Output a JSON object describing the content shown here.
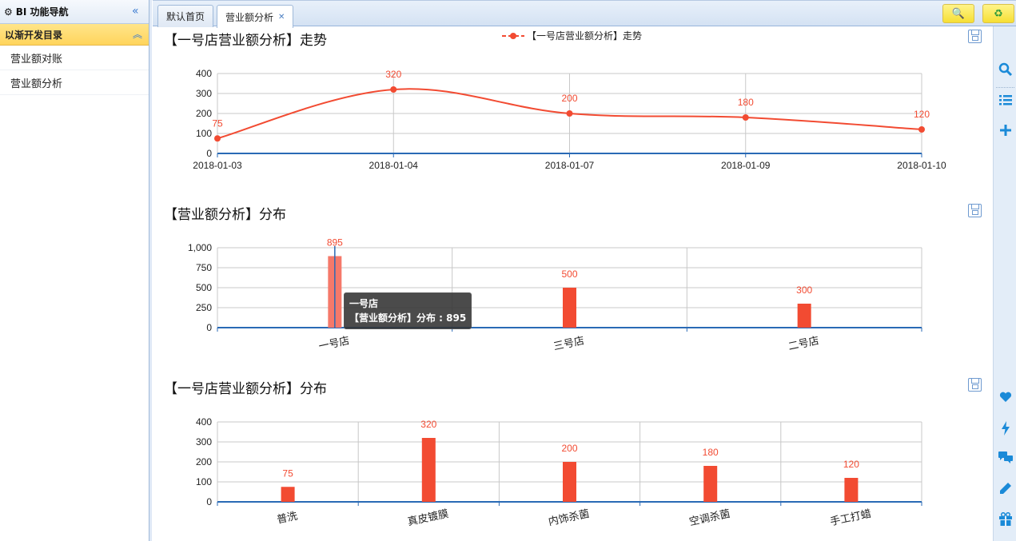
{
  "sidebar": {
    "title": "BI 功能导航",
    "group": "以渐开发目录",
    "items": [
      {
        "label": "营业额对账"
      },
      {
        "label": "营业额分析"
      }
    ]
  },
  "tabs": [
    {
      "label": "默认首页",
      "active": false
    },
    {
      "label": "营业额分析",
      "active": true,
      "closable": true
    }
  ],
  "toolbar": {
    "search_icon": "magnifier-icon",
    "refresh_icon": "recycle-icon"
  },
  "right_toolbar": [
    "search-icon",
    "list-icon",
    "plus-icon",
    "heart-icon",
    "lightning-icon",
    "chat-icon",
    "pencil-icon",
    "gift-icon"
  ],
  "colors": {
    "series": "#f24b32",
    "bar": "#f24b32",
    "bar_highlight": "#f5796a",
    "axis": "#2a6ab5"
  },
  "charts": {
    "trend": {
      "title": "【一号店营业额分析】走势",
      "legend": "【一号店营业额分析】走势"
    },
    "dist_store": {
      "title": "【营业额分析】分布",
      "tooltip_title": "一号店",
      "tooltip_value": "【营业额分析】分布 : 895"
    },
    "dist_service": {
      "title": "【一号店营业额分析】分布"
    }
  },
  "chart_data": [
    {
      "type": "line",
      "title": "【一号店营业额分析】走势",
      "x": [
        "2018-01-03",
        "2018-01-04",
        "2018-01-07",
        "2018-01-09",
        "2018-01-10"
      ],
      "series": [
        {
          "name": "【一号店营业额分析】走势",
          "values": [
            75,
            320,
            200,
            180,
            120
          ]
        }
      ],
      "yticks": [
        "0",
        "100",
        "200",
        "300",
        "400"
      ],
      "ylim": [
        0,
        400
      ],
      "grid": true,
      "legend": "top-center"
    },
    {
      "type": "bar",
      "title": "【营业额分析】分布",
      "categories": [
        "一号店",
        "三号店",
        "二号店"
      ],
      "values": [
        895,
        500,
        300
      ],
      "yticks": [
        "0",
        "250",
        "500",
        "750",
        "1,000"
      ],
      "ylim": [
        0,
        1000
      ],
      "grid": true
    },
    {
      "type": "bar",
      "title": "【一号店营业额分析】分布",
      "categories": [
        "普洗",
        "真皮镀膜",
        "内饰杀菌",
        "空调杀菌",
        "手工打蜡"
      ],
      "values": [
        75,
        320,
        200,
        180,
        120
      ],
      "yticks": [
        "0",
        "100",
        "200",
        "300",
        "400"
      ],
      "ylim": [
        0,
        400
      ],
      "grid": true
    }
  ]
}
